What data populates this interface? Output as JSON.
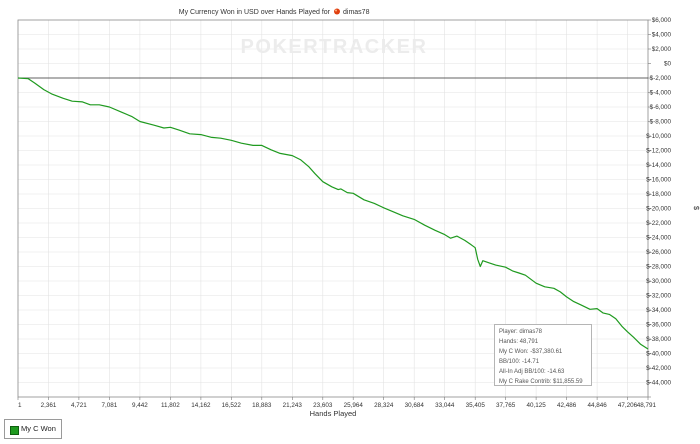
{
  "chart_data": {
    "type": "line",
    "title": "My Currency Won in USD over Hands Played for",
    "player": "dimas78",
    "watermark": "POKERTRACKER",
    "xlabel": "Hands Played",
    "ylabel": "$",
    "xlim": [
      1,
      48791
    ],
    "ylim": [
      -44000,
      8000
    ],
    "grid": true,
    "legend_placement": "bottom-left",
    "x_ticks": [
      1,
      2361,
      4721,
      7081,
      9442,
      11802,
      14162,
      16522,
      18883,
      21243,
      23603,
      25964,
      28324,
      30684,
      33044,
      35405,
      37765,
      40125,
      42486,
      44846,
      47206,
      48791
    ],
    "x_tick_labels": [
      "1",
      "2,361",
      "4,721",
      "7,081",
      "9,442",
      "11,802",
      "14,162",
      "16,522",
      "18,883",
      "21,243",
      "23,603",
      "25,964",
      "28,324",
      "30,684",
      "33,044",
      "35,405",
      "37,765",
      "40,125",
      "42,486",
      "44,846",
      "47,206",
      "48,791"
    ],
    "y_ticks": [
      8000,
      6000,
      4000,
      2000,
      0,
      -2000,
      -4000,
      -6000,
      -8000,
      -10000,
      -12000,
      -14000,
      -16000,
      -18000,
      -20000,
      -22000,
      -24000,
      -26000,
      -28000,
      -30000,
      -32000,
      -34000,
      -36000,
      -38000,
      -40000,
      -42000,
      -44000
    ],
    "y_tick_labels": [
      "$6,000",
      "$4,000",
      "$2,000",
      "$0",
      "$-2,000",
      "$-4,000",
      "$-6,000",
      "$-8,000",
      "$-10,000",
      "$-12,000",
      "$-14,000",
      "$-16,000",
      "$-18,000",
      "$-20,000",
      "$-22,000",
      "$-24,000",
      "$-26,000",
      "$-28,000",
      "$-30,000",
      "$-32,000",
      "$-34,000",
      "$-36,000",
      "$-38,000",
      "$-40,000",
      "$-42,000",
      "$-44,000"
    ],
    "series": [
      {
        "name": "My C Won",
        "color": "#1f9a1f",
        "x": [
          1,
          800,
          1300,
          2000,
          2600,
          3500,
          4200,
          5000,
          5600,
          6300,
          7081,
          8000,
          8800,
          9442,
          10500,
          11300,
          11802,
          12500,
          13300,
          14162,
          15000,
          15700,
          16522,
          17300,
          18200,
          18883,
          19600,
          20300,
          21243,
          21900,
          22500,
          23000,
          23603,
          24300,
          24800,
          25000,
          25500,
          25964,
          26800,
          27600,
          28324,
          29000,
          29800,
          30684,
          31500,
          32300,
          33044,
          33500,
          34000,
          34600,
          35100,
          35405,
          35600,
          35800,
          36000,
          36500,
          37000,
          37765,
          38300,
          38800,
          39300,
          40125,
          40800,
          41500,
          42000,
          42486,
          43000,
          43600,
          44300,
          44846,
          45300,
          45800,
          46300,
          46800,
          47206,
          47700,
          48200,
          48791
        ],
        "y": [
          0,
          -100,
          -700,
          -1600,
          -2200,
          -2800,
          -3200,
          -3300,
          -3700,
          -3700,
          -4000,
          -4700,
          -5300,
          -6000,
          -6500,
          -6900,
          -6800,
          -7200,
          -7700,
          -7800,
          -8200,
          -8300,
          -8600,
          -9000,
          -9300,
          -9300,
          -9900,
          -10400,
          -10700,
          -11300,
          -12200,
          -13200,
          -14300,
          -15000,
          -15400,
          -15300,
          -15800,
          -15900,
          -16800,
          -17300,
          -17900,
          -18400,
          -19000,
          -19500,
          -20300,
          -21000,
          -21600,
          -22100,
          -21800,
          -22400,
          -23000,
          -23400,
          -25000,
          -26000,
          -25200,
          -25500,
          -25800,
          -26100,
          -26600,
          -26900,
          -27200,
          -28300,
          -28800,
          -29000,
          -29500,
          -30200,
          -30800,
          -31300,
          -31900,
          -31800,
          -32400,
          -32600,
          -33200,
          -34300,
          -35000,
          -35800,
          -36700,
          -37380.61
        ]
      }
    ]
  },
  "legend": {
    "label": "My C Won"
  },
  "stats": {
    "player": "Player: dimas78",
    "hands": "Hands: 48,791",
    "won": "My C Won: -$37,380.61",
    "bb100": "BB/100: -14.71",
    "allin": "All-In Adj BB/100: -14.63",
    "rake": "My C Rake Contrib: $11,855.59"
  }
}
